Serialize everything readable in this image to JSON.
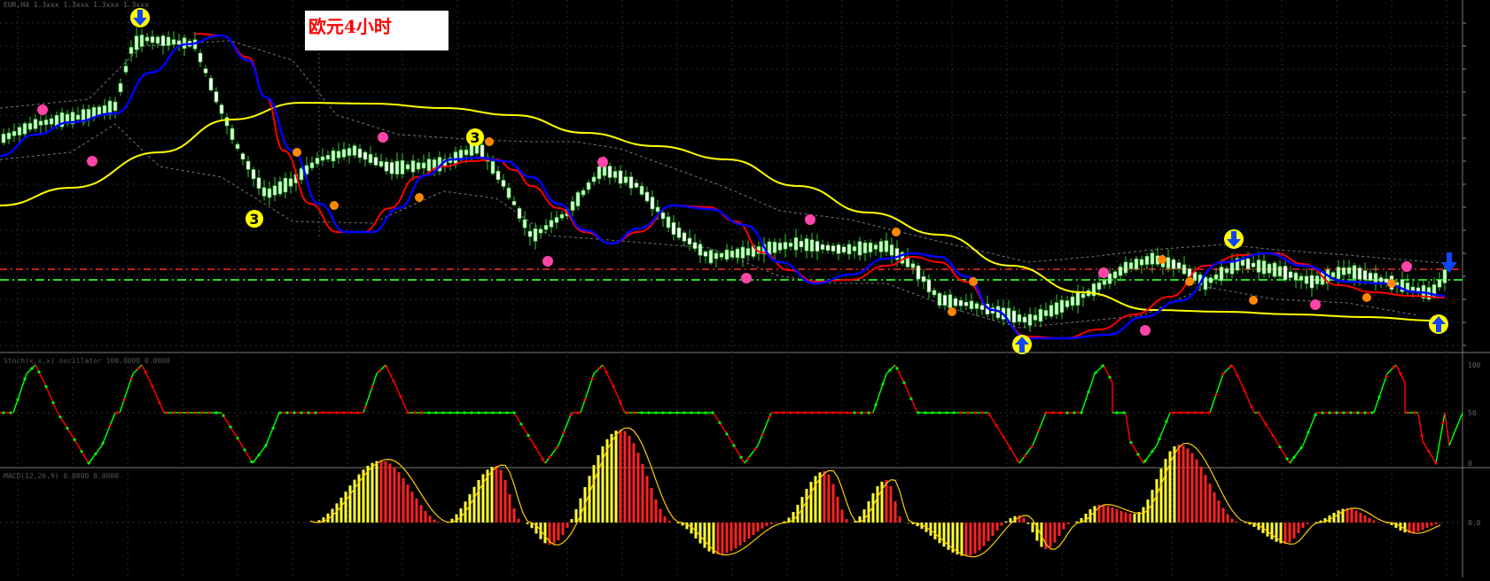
{
  "app": {
    "title_label": "欧元4小时",
    "main_panel_header": "EUR,H4 1.3xxx 1.3xxx 1.3xxx 1.3xxx",
    "osc_panel_header": "Stoch(x,x,x) oscillator 100.0000 0.0000",
    "macd_panel_header": "MACD(12,26,9) 0.0000 0.0000"
  },
  "colors": {
    "background": "#000000",
    "grid": "#2a2a2a",
    "bull_candle": "#c8ffc8",
    "bear_candle": "#ffffff",
    "wick": "#33cc33",
    "ma_red": "#ff0000",
    "ma_blue": "#0000ff",
    "ma_yellow": "#ffff00",
    "level_red": "#ff2a2a",
    "level_green": "#22dd22",
    "osc_up": "#00ff00",
    "osc_down": "#ff0000",
    "macd_pos": "#ffff33",
    "macd_neg": "#ff2222",
    "macd_signal": "#ffcc00",
    "marker_pink": "#ff44aa",
    "marker_orange": "#ff8800",
    "marker_yellow": "#ffff00",
    "arrow_blue": "#1144ff"
  },
  "chart_data": {
    "type": "candlestick",
    "title": "欧元4小时",
    "price_ticks": [
      "",
      "",
      "",
      "",
      "",
      "",
      "",
      "",
      "",
      "",
      "",
      "",
      ""
    ],
    "osc_ticks": [
      "100",
      "50",
      "0"
    ],
    "macd_ticks": [
      "0.0"
    ],
    "markers": {
      "yellow_circle_number": "3",
      "down_arrow_icon": "down-arrow",
      "up_arrow_icon": "up-arrow"
    }
  }
}
